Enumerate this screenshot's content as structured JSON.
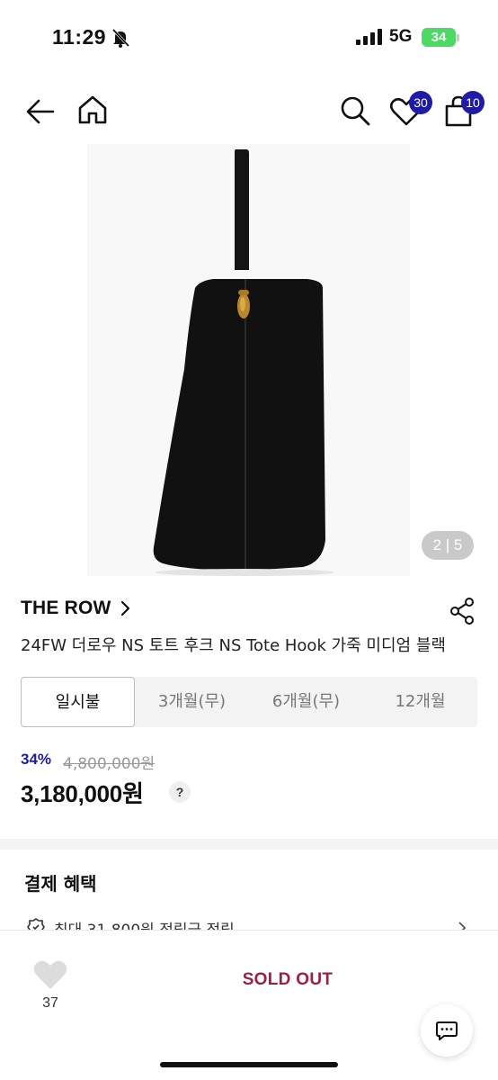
{
  "status_bar": {
    "time": "11:29",
    "network": "5G",
    "battery": "34"
  },
  "header": {
    "wishlist_count": "30",
    "cart_count": "10",
    "icons": [
      "back-arrow-icon",
      "home-icon",
      "search-icon",
      "heart-icon",
      "shopping-bag-icon"
    ]
  },
  "gallery": {
    "counter": "2 | 5",
    "current": 2,
    "total": 5
  },
  "product": {
    "brand": "THE ROW",
    "title": "24FW 더로우 NS 토트 후크 NS Tote Hook 가죽 미디엄 블랙"
  },
  "installment_tabs": [
    {
      "label": "일시불",
      "active": true
    },
    {
      "label": "3개월(무)",
      "active": false
    },
    {
      "label": "6개월(무)",
      "active": false
    },
    {
      "label": "12개월",
      "active": false
    }
  ],
  "price": {
    "discount_rate": "34%",
    "original": "4,800,000원",
    "sale": "3,180,000원",
    "help": "?"
  },
  "benefits": {
    "title": "결제 혜택",
    "items": [
      {
        "text": "최대 31,800원 적립금 적립"
      }
    ]
  },
  "bottom_bar": {
    "like_count": "37",
    "purchase_label": "SOLD OUT"
  },
  "colors": {
    "accent_blue": "#1f1aa8",
    "soldout_red": "#9c1f45",
    "battery_green": "#4cd964"
  }
}
